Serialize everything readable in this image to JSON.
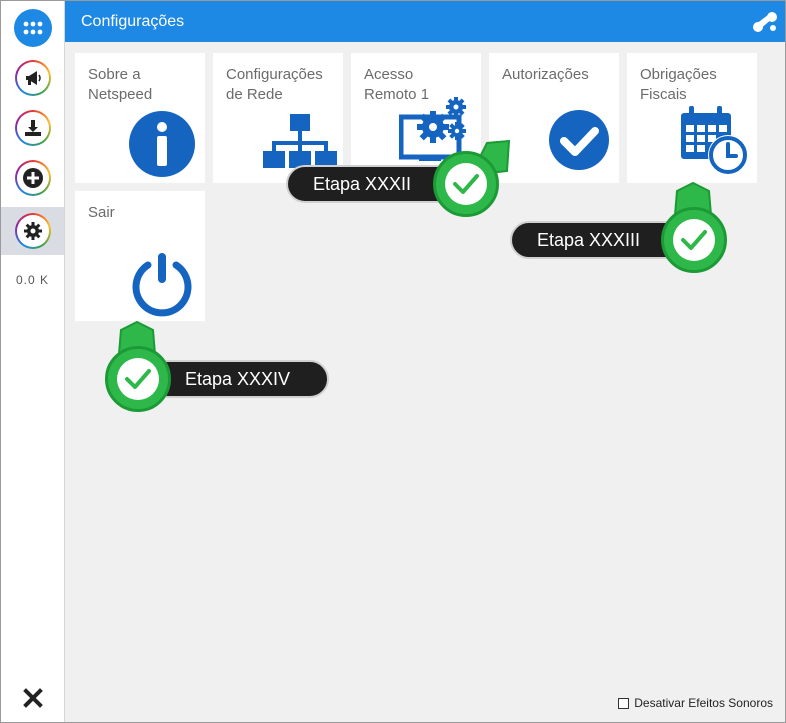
{
  "header": {
    "title": "Configurações",
    "logo_icon": "netspeed-logo-icon"
  },
  "sidebar": {
    "items": [
      {
        "name": "apps-menu",
        "icon": "grid-dots-icon"
      },
      {
        "name": "announcements",
        "icon": "megaphone-icon"
      },
      {
        "name": "downloads",
        "icon": "download-tray-icon"
      },
      {
        "name": "add",
        "icon": "plus-circle-icon"
      },
      {
        "name": "settings",
        "icon": "gear-icon",
        "active": true
      }
    ],
    "counter": "0.0 K",
    "close_icon": "close-icon"
  },
  "tiles": [
    {
      "label": "Sobre a\nNetspeed",
      "icon": "info-icon"
    },
    {
      "label": "Configurações\nde Rede",
      "icon": "network-tree-icon"
    },
    {
      "label": "Acesso\nRemoto 1",
      "icon": "remote-gears-icon"
    },
    {
      "label": "Autorizações",
      "icon": "checkmark-circle-icon"
    },
    {
      "label": "Obrigações\nFiscais",
      "icon": "calendar-clock-icon"
    },
    {
      "label": "Sair",
      "icon": "power-icon"
    }
  ],
  "callouts": [
    {
      "text": "Etapa XXXII"
    },
    {
      "text": "Etapa XXXIII"
    },
    {
      "text": "Etapa XXXIV"
    }
  ],
  "footer": {
    "sound_toggle_label": "Desativar Efeitos Sonoros",
    "checked": false
  },
  "colors": {
    "accent": "#1e88e5",
    "tile_icon": "#1565c0",
    "success": "#2fb84a",
    "callout_bg": "#1f1f1f"
  }
}
